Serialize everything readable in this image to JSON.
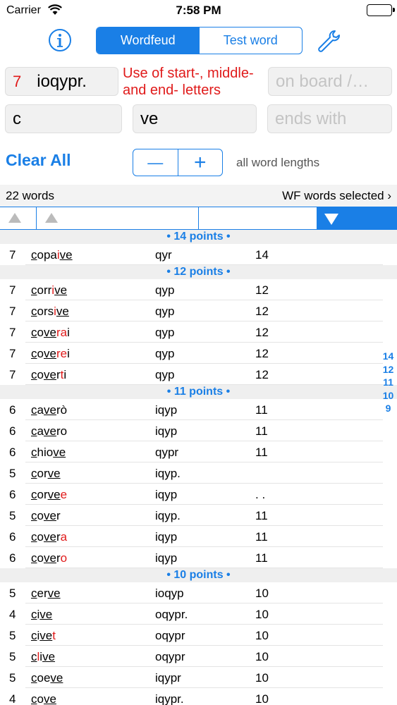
{
  "status_bar": {
    "carrier": "Carrier",
    "time": "7:58 PM"
  },
  "toolbar": {
    "tabs": [
      {
        "label": "Wordfeud",
        "active": true
      },
      {
        "label": "Test word",
        "active": false
      }
    ]
  },
  "inputs": {
    "length": "7",
    "letters": "ioqypr.",
    "on_board_placeholder": "on board /…",
    "starts_with": "c",
    "contains": "ve",
    "ends_with_placeholder": "ends with",
    "hint": "Use of start-, middle- and end- letters"
  },
  "controls": {
    "clear_all": "Clear All",
    "minus": "—",
    "plus": "+",
    "word_lengths": "all word lengths"
  },
  "summary": {
    "count": "22 words",
    "wf_selected": "WF words selected ›"
  },
  "sections": [
    {
      "title": "• 14 points •",
      "rows": [
        {
          "len": "7",
          "rack": "qyr",
          "points": "14",
          "word": [
            {
              "t": "c",
              "s": "ul"
            },
            {
              "t": "opa",
              "s": ""
            },
            {
              "t": "i",
              "s": "red"
            },
            {
              "t": "ve",
              "s": "ul"
            }
          ]
        }
      ]
    },
    {
      "title": "• 12 points •",
      "rows": [
        {
          "len": "7",
          "rack": "qyp",
          "points": "12",
          "word": [
            {
              "t": "c",
              "s": "ul"
            },
            {
              "t": "orr",
              "s": ""
            },
            {
              "t": "i",
              "s": "red"
            },
            {
              "t": "ve",
              "s": "ul"
            }
          ]
        },
        {
          "len": "7",
          "rack": "qyp",
          "points": "12",
          "word": [
            {
              "t": "c",
              "s": "ul"
            },
            {
              "t": "ors",
              "s": ""
            },
            {
              "t": "i",
              "s": "red"
            },
            {
              "t": "ve",
              "s": "ul"
            }
          ]
        },
        {
          "len": "7",
          "rack": "qyp",
          "points": "12",
          "word": [
            {
              "t": "c",
              "s": "ul"
            },
            {
              "t": "o",
              "s": ""
            },
            {
              "t": "ve",
              "s": "ul"
            },
            {
              "t": "ra",
              "s": "red"
            },
            {
              "t": "i",
              "s": ""
            }
          ]
        },
        {
          "len": "7",
          "rack": "qyp",
          "points": "12",
          "word": [
            {
              "t": "c",
              "s": "ul"
            },
            {
              "t": "o",
              "s": ""
            },
            {
              "t": "ve",
              "s": "ul"
            },
            {
              "t": "re",
              "s": "red"
            },
            {
              "t": "i",
              "s": ""
            }
          ]
        },
        {
          "len": "7",
          "rack": "qyp",
          "points": "12",
          "word": [
            {
              "t": "c",
              "s": "ul"
            },
            {
              "t": "o",
              "s": ""
            },
            {
              "t": "ve",
              "s": "ul"
            },
            {
              "t": "r",
              "s": ""
            },
            {
              "t": "t",
              "s": "red"
            },
            {
              "t": "i",
              "s": ""
            }
          ]
        }
      ]
    },
    {
      "title": "• 11 points •",
      "rows": [
        {
          "len": "6",
          "rack": "iqyp",
          "points": "11",
          "word": [
            {
              "t": "c",
              "s": "ul"
            },
            {
              "t": "a",
              "s": ""
            },
            {
              "t": "ve",
              "s": "ul"
            },
            {
              "t": "rò",
              "s": ""
            }
          ]
        },
        {
          "len": "6",
          "rack": "iqyp",
          "points": "11",
          "word": [
            {
              "t": "c",
              "s": "ul"
            },
            {
              "t": "a",
              "s": ""
            },
            {
              "t": "ve",
              "s": "ul"
            },
            {
              "t": "ro",
              "s": ""
            }
          ]
        },
        {
          "len": "6",
          "rack": "qypr",
          "points": "11",
          "word": [
            {
              "t": "c",
              "s": "ul"
            },
            {
              "t": "hio",
              "s": ""
            },
            {
              "t": "ve",
              "s": "ul"
            }
          ]
        },
        {
          "len": "5",
          "rack": "iqyp.",
          "points": "",
          "word": [
            {
              "t": "c",
              "s": "ul"
            },
            {
              "t": "or",
              "s": ""
            },
            {
              "t": "ve",
              "s": "ul"
            }
          ]
        },
        {
          "len": "6",
          "rack": "iqyp",
          "points": ". .",
          "word": [
            {
              "t": "c",
              "s": "ul"
            },
            {
              "t": "or",
              "s": ""
            },
            {
              "t": "ve",
              "s": "ul"
            },
            {
              "t": "e",
              "s": "red"
            }
          ]
        },
        {
          "len": "5",
          "rack": "iqyp.",
          "points": "11",
          "word": [
            {
              "t": "c",
              "s": "ul"
            },
            {
              "t": "o",
              "s": ""
            },
            {
              "t": "ve",
              "s": "ul"
            },
            {
              "t": "r",
              "s": ""
            }
          ]
        },
        {
          "len": "6",
          "rack": "iqyp",
          "points": "11",
          "word": [
            {
              "t": "c",
              "s": "ul"
            },
            {
              "t": "o",
              "s": ""
            },
            {
              "t": "ve",
              "s": "ul"
            },
            {
              "t": "r",
              "s": ""
            },
            {
              "t": "a",
              "s": "red"
            }
          ]
        },
        {
          "len": "6",
          "rack": "iqyp",
          "points": "11",
          "word": [
            {
              "t": "c",
              "s": "ul"
            },
            {
              "t": "o",
              "s": ""
            },
            {
              "t": "ve",
              "s": "ul"
            },
            {
              "t": "r",
              "s": ""
            },
            {
              "t": "o",
              "s": "red"
            }
          ]
        }
      ]
    },
    {
      "title": "• 10 points •",
      "rows": [
        {
          "len": "5",
          "rack": "ioqyp",
          "points": "10",
          "word": [
            {
              "t": "c",
              "s": "ul"
            },
            {
              "t": "er",
              "s": ""
            },
            {
              "t": "ve",
              "s": "ul"
            }
          ]
        },
        {
          "len": "4",
          "rack": "oqypr.",
          "points": "10",
          "word": [
            {
              "t": "c",
              "s": "ul"
            },
            {
              "t": "i",
              "s": ""
            },
            {
              "t": "ve",
              "s": "ul"
            }
          ]
        },
        {
          "len": "5",
          "rack": "oqypr",
          "points": "10",
          "word": [
            {
              "t": "c",
              "s": "ul"
            },
            {
              "t": "i",
              "s": ""
            },
            {
              "t": "ve",
              "s": "ul"
            },
            {
              "t": "t",
              "s": "red"
            }
          ]
        },
        {
          "len": "5",
          "rack": "oqypr",
          "points": "10",
          "word": [
            {
              "t": "c",
              "s": "ul"
            },
            {
              "t": "l",
              "s": "red"
            },
            {
              "t": "i",
              "s": ""
            },
            {
              "t": "ve",
              "s": "ul"
            }
          ]
        },
        {
          "len": "5",
          "rack": "iqypr",
          "points": "10",
          "word": [
            {
              "t": "c",
              "s": "ul"
            },
            {
              "t": "oe",
              "s": ""
            },
            {
              "t": "ve",
              "s": "ul"
            }
          ]
        },
        {
          "len": "4",
          "rack": "iqypr.",
          "points": "10",
          "word": [
            {
              "t": "c",
              "s": "ul"
            },
            {
              "t": "o",
              "s": ""
            },
            {
              "t": "ve",
              "s": "ul"
            }
          ]
        }
      ]
    }
  ],
  "index": [
    "14",
    "12",
    "11",
    "10",
    "9"
  ],
  "colors": {
    "accent": "#1a7fe6",
    "highlight": "#e01a1a"
  }
}
